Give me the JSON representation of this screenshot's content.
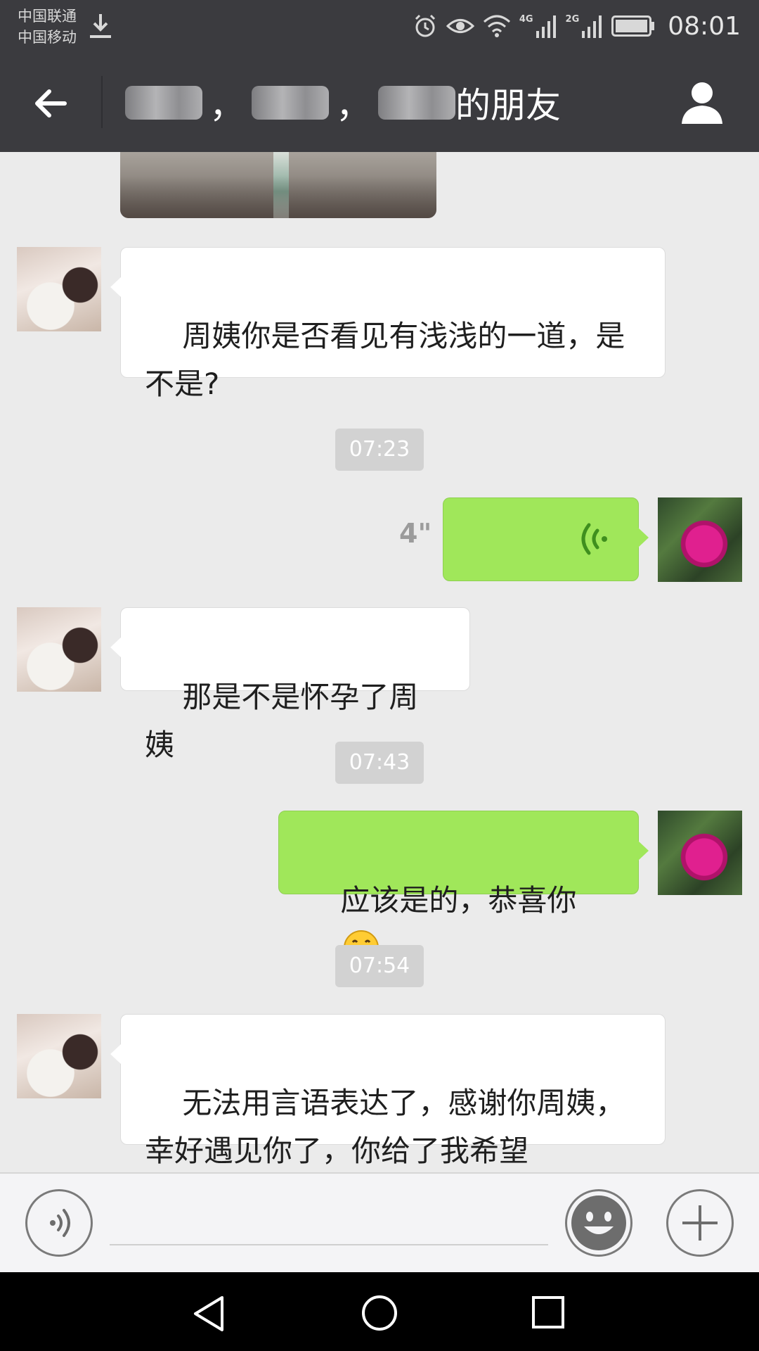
{
  "status_bar": {
    "carrier_1": "中国联通",
    "carrier_2": "中国移动",
    "net_4g": "4G",
    "net_2g": "2G",
    "time": "08:01",
    "icons": [
      "download-icon",
      "alarm-icon",
      "eye-icon",
      "wifi-icon",
      "signal-icon",
      "battery-icon"
    ]
  },
  "header": {
    "title_sep_1": "，",
    "title_sep_2": "，",
    "title_suffix": "的朋友",
    "back_icon": "arrow-left-icon",
    "contact_icon": "person-icon"
  },
  "messages": {
    "m1": {
      "text": "周姨你是否看见有浅浅的一道，是\n不是?"
    },
    "t1": "07:23",
    "voice": {
      "duration": "4\""
    },
    "m2": {
      "text": "那是不是怀孕了周姨"
    },
    "t2": "07:43",
    "m3": {
      "text": "应该是的，恭喜你"
    },
    "t3": "07:54",
    "m4": {
      "text": "无法用言语表达了，感谢你周姨，\n幸好遇见你了，你给了我希望"
    }
  },
  "input_bar": {
    "placeholder": "",
    "icons": [
      "voice-input-icon",
      "emoji-icon",
      "plus-icon"
    ]
  },
  "nav": {
    "icons": [
      "nav-back-icon",
      "nav-home-icon",
      "nav-recents-icon"
    ]
  },
  "colors": {
    "header_bg": "#3b3b3f",
    "chat_bg": "#ebebeb",
    "sent_bubble": "#a0e75a",
    "received_bubble": "#ffffff",
    "timestamp_bg": "#d2d2d2"
  }
}
